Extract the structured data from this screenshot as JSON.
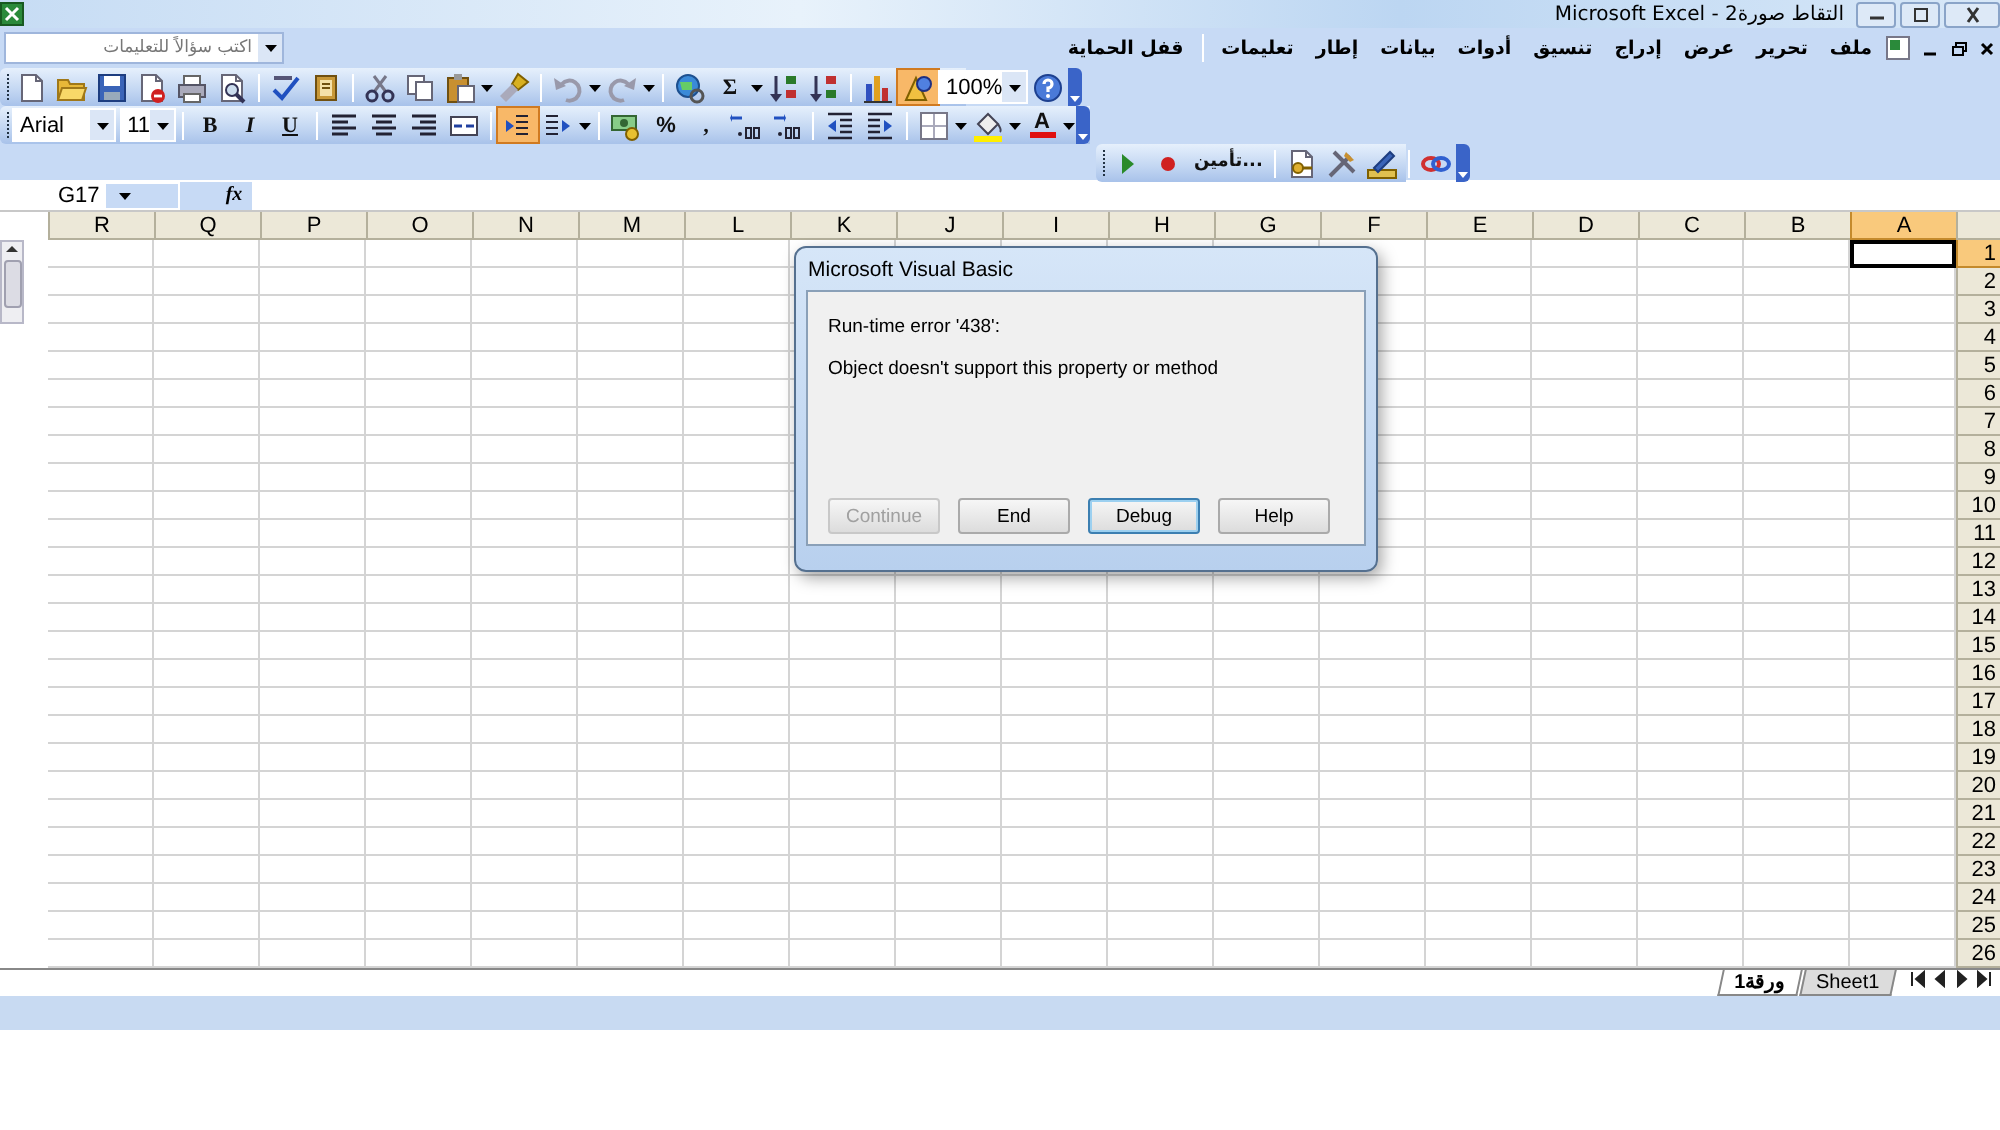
{
  "window": {
    "title": "Microsoft Excel - التقاط صورة2"
  },
  "menu": {
    "ask_placeholder": "اكتب سؤالاً للتعليمات",
    "items": [
      "ملف",
      "تحرير",
      "عرض",
      "إدراج",
      "تنسيق",
      "أدوات",
      "بيانات",
      "إطار",
      "تعليمات"
    ],
    "extra_items": [
      "قفل الحماية"
    ]
  },
  "standard_toolbar": {
    "sum": "Σ",
    "zoom": "100%",
    "drawing_on": true
  },
  "formatting_toolbar": {
    "font": "Arial",
    "size": "11",
    "style_buttons": [
      "U",
      "I",
      "B"
    ],
    "right_to_left_on": true,
    "percent": "%",
    "comma": ",",
    "font_color": "A"
  },
  "protection_toolbar": {
    "protect": "تأمين..."
  },
  "formula_bar": {
    "name_box": "G17",
    "fx": "fx"
  },
  "sheet": {
    "columns": [
      {
        "label": "A",
        "selected": true
      },
      {
        "label": "B",
        "selected": false
      },
      {
        "label": "C",
        "selected": false
      },
      {
        "label": "D",
        "selected": false
      },
      {
        "label": "E",
        "selected": false
      },
      {
        "label": "F",
        "selected": false
      },
      {
        "label": "G",
        "selected": false
      },
      {
        "label": "H",
        "selected": false
      },
      {
        "label": "I",
        "selected": false
      },
      {
        "label": "J",
        "selected": false
      },
      {
        "label": "K",
        "selected": false
      },
      {
        "label": "L",
        "selected": false
      },
      {
        "label": "M",
        "selected": false
      },
      {
        "label": "N",
        "selected": false
      },
      {
        "label": "O",
        "selected": false
      },
      {
        "label": "P",
        "selected": false
      },
      {
        "label": "Q",
        "selected": false
      },
      {
        "label": "R",
        "selected": false
      }
    ],
    "rows": [
      {
        "label": "1",
        "selected": true
      },
      {
        "label": "2",
        "selected": false
      },
      {
        "label": "3",
        "selected": false
      },
      {
        "label": "4",
        "selected": false
      },
      {
        "label": "5",
        "selected": false
      },
      {
        "label": "6",
        "selected": false
      },
      {
        "label": "7",
        "selected": false
      },
      {
        "label": "8",
        "selected": false
      },
      {
        "label": "9",
        "selected": false
      },
      {
        "label": "10",
        "selected": false
      },
      {
        "label": "11",
        "selected": false
      },
      {
        "label": "12",
        "selected": false
      },
      {
        "label": "13",
        "selected": false
      },
      {
        "label": "14",
        "selected": false
      },
      {
        "label": "15",
        "selected": false
      },
      {
        "label": "16",
        "selected": false
      },
      {
        "label": "17",
        "selected": false
      },
      {
        "label": "18",
        "selected": false
      },
      {
        "label": "19",
        "selected": false
      },
      {
        "label": "20",
        "selected": false
      },
      {
        "label": "21",
        "selected": false
      },
      {
        "label": "22",
        "selected": false
      },
      {
        "label": "23",
        "selected": false
      },
      {
        "label": "24",
        "selected": false
      },
      {
        "label": "25",
        "selected": false
      },
      {
        "label": "26",
        "selected": false
      }
    ]
  },
  "sheet_tabs": [
    {
      "label": "Sheet1",
      "selected": false
    },
    {
      "label": "ورقة1",
      "selected": true
    }
  ],
  "dialog": {
    "title": "Microsoft Visual Basic",
    "error": "Run-time error '438':",
    "message": "Object doesn't support this property or method",
    "buttons": [
      {
        "label": "Help",
        "disabled": false,
        "default": false
      },
      {
        "label": "Debug",
        "disabled": false,
        "default": true
      },
      {
        "label": "End",
        "disabled": false,
        "default": false
      },
      {
        "label": "Continue",
        "disabled": true,
        "default": false
      }
    ]
  }
}
